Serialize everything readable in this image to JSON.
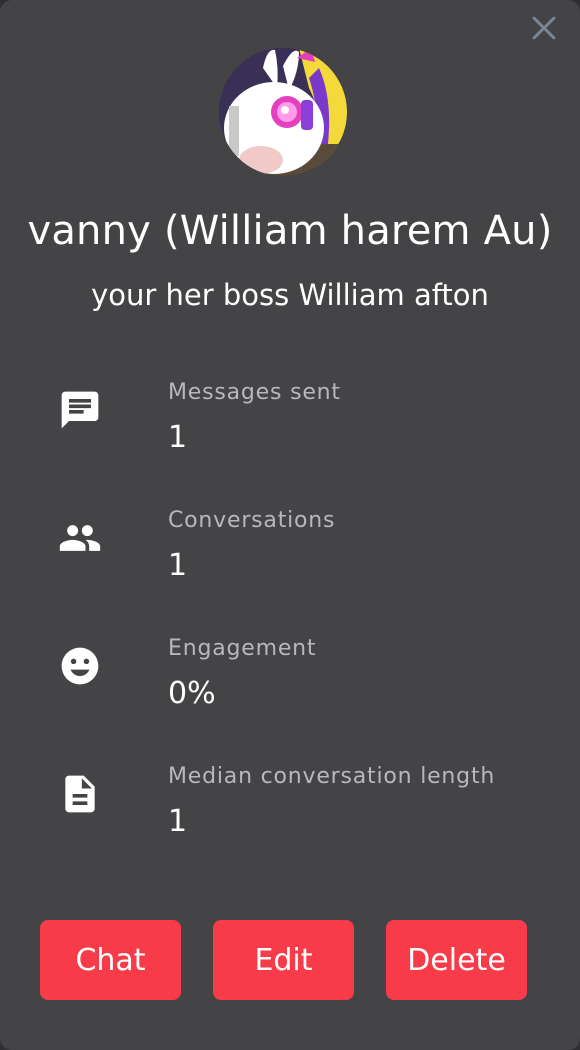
{
  "close": {
    "icon": "close-icon",
    "color": "#7a8896"
  },
  "profile": {
    "name": "vanny (William harem Au)",
    "tagline": "your her boss William afton"
  },
  "stats": [
    {
      "icon": "chat-bubble-icon",
      "label": "Messages sent",
      "value": "1"
    },
    {
      "icon": "people-icon",
      "label": "Conversations",
      "value": "1"
    },
    {
      "icon": "smiley-face-icon",
      "label": "Engagement",
      "value": "0%"
    },
    {
      "icon": "document-icon",
      "label": "Median conversation length",
      "value": "1"
    }
  ],
  "actions": {
    "chat_label": "Chat",
    "edit_label": "Edit",
    "delete_label": "Delete",
    "accent": "#f73b48"
  },
  "colors": {
    "background": "#444446",
    "label": "#b8b8bb",
    "text": "#ffffff"
  }
}
